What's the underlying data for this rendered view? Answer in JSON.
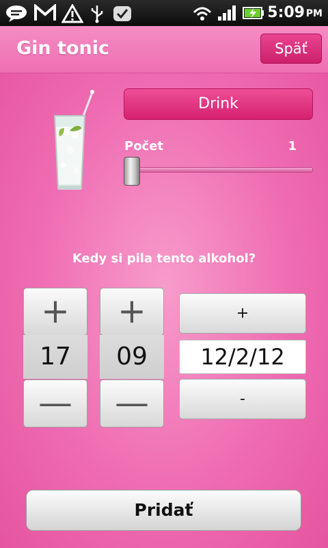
{
  "status_bar": {
    "time": "5:09",
    "ampm": "PM",
    "icons": [
      "message-icon",
      "gmail-icon",
      "warning-icon",
      "usb-icon",
      "task-check-icon",
      "wifi-icon",
      "signal-icon",
      "battery-icon"
    ]
  },
  "header": {
    "title": "Gin tonic",
    "back_label": "Späť"
  },
  "drink": {
    "image": "gin-tonic-glass",
    "button_label": "Drink"
  },
  "count": {
    "label": "Počet",
    "value": "1"
  },
  "time_picker": {
    "question": "Kedy si pila tento alkohol?",
    "plus_symbol": "+",
    "minus_symbol": "—",
    "hour": "17",
    "minute": "09",
    "date": "12/2/12",
    "date_plus_label": "+",
    "date_minus_label": "-"
  },
  "footer": {
    "add_label": "Pridať"
  },
  "colors": {
    "accent": "#d52070",
    "background": "#f06ab0"
  }
}
